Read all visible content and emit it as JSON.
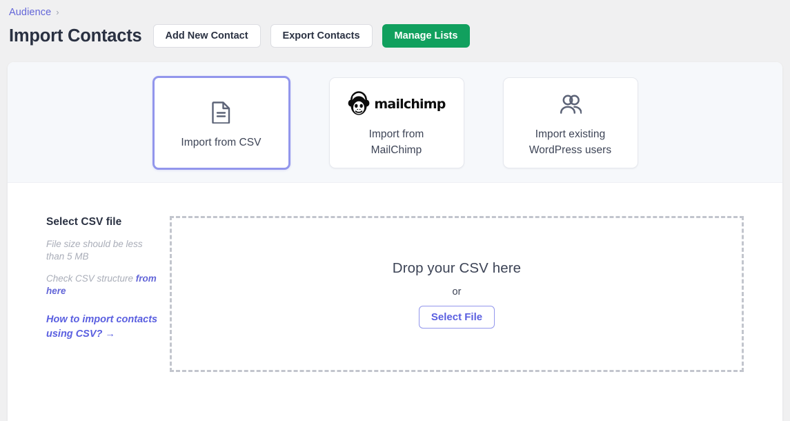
{
  "header": {
    "breadcrumb": {
      "parent": "Audience",
      "separator": "›"
    },
    "title": "Import Contacts",
    "buttons": {
      "add_new_contact": "Add New Contact",
      "export_contacts": "Export Contacts",
      "manage_lists": "Manage Lists"
    }
  },
  "sources": [
    {
      "id": "csv",
      "label": "Import from CSV",
      "icon": "document-icon",
      "selected": true
    },
    {
      "id": "mailchimp",
      "label": "Import from\nMailChimp",
      "label_line1": "Import from",
      "label_line2": "MailChimp",
      "icon": "mailchimp-logo",
      "wordmark": "mailchimp",
      "selected": false
    },
    {
      "id": "wordpress",
      "label": "Import existing\nWordPress users",
      "label_line1": "Import existing",
      "label_line2": "WordPress users",
      "icon": "users-icon",
      "selected": false
    }
  ],
  "select_csv": {
    "heading": "Select CSV file",
    "size_note": "File size should be less than 5 MB",
    "structure_note_prefix": "Check CSV structure ",
    "structure_note_link": "from here",
    "help_link": "How to import contacts using CSV? →"
  },
  "dropzone": {
    "title": "Drop your CSV here",
    "or": "or",
    "select_file_button": "Select File"
  },
  "colors": {
    "accent_purple": "#5a5fe0",
    "breadcrumb_purple": "#6366d8",
    "primary_green": "#11a05e",
    "selected_border": "#9296ec",
    "dashed_border": "#c2c5cd",
    "panel_bg": "#f6f8fb",
    "page_bg": "#f0f0f1",
    "title_dark": "#2a3142",
    "muted_italic": "#a9adb8"
  }
}
